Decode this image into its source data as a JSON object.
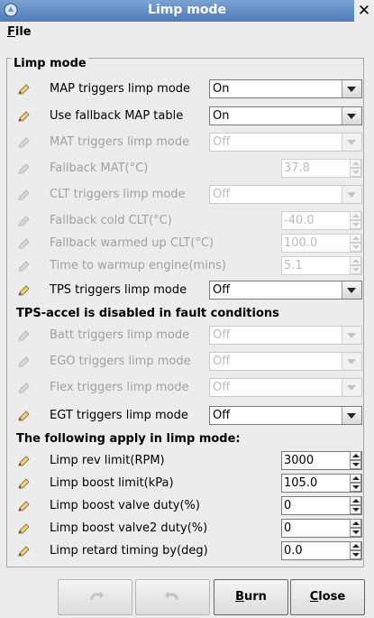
{
  "window": {
    "title": "Limp mode"
  },
  "menu": {
    "file_first": "F",
    "file_rest": "ile"
  },
  "group": {
    "title": "Limp mode"
  },
  "rows_a": [
    {
      "label": "MAP triggers limp mode",
      "value": "On",
      "enabled": true
    },
    {
      "label": "Use fallback MAP table",
      "value": "On",
      "enabled": true
    },
    {
      "label": "MAT triggers limp mode",
      "value": "Off",
      "enabled": false
    },
    {
      "label": "Fallback MAT(°C)",
      "value": "37.8",
      "enabled": false
    },
    {
      "label": "CLT triggers limp mode",
      "value": "Off",
      "enabled": false
    },
    {
      "label": "Fallback cold CLT(°C)",
      "value": "-40.0",
      "enabled": false
    },
    {
      "label": "Fallback warmed up CLT(°C)",
      "value": "100.0",
      "enabled": false
    },
    {
      "label": "Time to warmup engine(mins)",
      "value": "5.1",
      "enabled": false
    },
    {
      "label": "TPS triggers limp mode",
      "value": "Off",
      "enabled": true
    }
  ],
  "tps_note": "TPS-accel is disabled in fault conditions",
  "rows_b": [
    {
      "label": "Batt triggers limp mode",
      "value": "Off",
      "enabled": false
    },
    {
      "label": "EGO triggers limp mode",
      "value": "Off",
      "enabled": false
    },
    {
      "label": "Flex triggers limp mode",
      "value": "Off",
      "enabled": false
    },
    {
      "label": "EGT triggers limp mode",
      "value": "Off",
      "enabled": true
    }
  ],
  "apply_note": "The following apply in limp mode:",
  "rows_c": [
    {
      "label": "Limp rev limit(RPM)",
      "value": "3000",
      "enabled": true
    },
    {
      "label": "Limp boost limit(kPa)",
      "value": "105.0",
      "enabled": true
    },
    {
      "label": "Limp boost valve duty(%)",
      "value": "0",
      "enabled": true
    },
    {
      "label": "Limp boost valve2 duty(%)",
      "value": "0",
      "enabled": true
    },
    {
      "label": "Limp retard timing by(deg)",
      "value": "0.0",
      "enabled": true
    }
  ],
  "buttons": {
    "burn_first": "B",
    "burn_rest": "urn",
    "close_first": "C",
    "close_rest": "lose"
  },
  "icons": {
    "title": "app-icon",
    "close": "close-icon",
    "row": "pencil-icon",
    "undo": "undo-icon",
    "redo": "redo-icon"
  }
}
